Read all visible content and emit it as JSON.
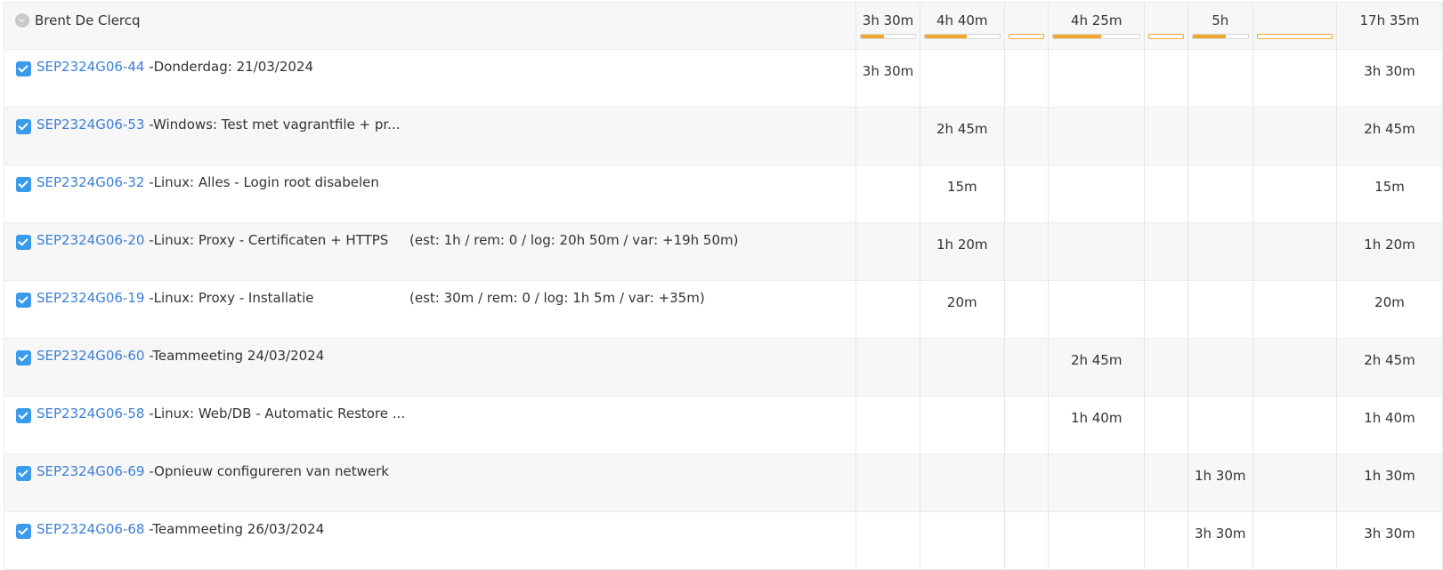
{
  "user": {
    "name": "Brent De Clercq"
  },
  "day_totals": [
    "3h 30m",
    "4h 40m",
    "",
    "4h 25m",
    "",
    "5h",
    "",
    "17h 35m"
  ],
  "day_progress": [
    0.42,
    0.56,
    0,
    0.55,
    0,
    0.6,
    0
  ],
  "rows": [
    {
      "key": "SEP2324G06-44",
      "title": " -Donderdag: 21/03/2024",
      "est": "",
      "values": [
        "3h 30m",
        "",
        "",
        "",
        "",
        "",
        "",
        "3h 30m"
      ]
    },
    {
      "key": "SEP2324G06-53",
      "title": " -Windows: Test met vagrantfile + pr...",
      "est": "",
      "values": [
        "",
        "2h 45m",
        "",
        "",
        "",
        "",
        "",
        "2h 45m"
      ]
    },
    {
      "key": "SEP2324G06-32",
      "title": " -Linux: Alles - Login root disabelen",
      "est": "",
      "values": [
        "",
        "15m",
        "",
        "",
        "",
        "",
        "",
        "15m"
      ]
    },
    {
      "key": "SEP2324G06-20",
      "title": " -Linux: Proxy - Certificaten + HTTPS",
      "est": "(est: 1h / rem: 0 / log: 20h 50m / var: +19h 50m)",
      "values": [
        "",
        "1h 20m",
        "",
        "",
        "",
        "",
        "",
        "1h 20m"
      ]
    },
    {
      "key": "SEP2324G06-19",
      "title": " -Linux: Proxy - Installatie",
      "est": "(est: 30m / rem: 0 / log: 1h 5m / var: +35m)",
      "values": [
        "",
        "20m",
        "",
        "",
        "",
        "",
        "",
        "20m"
      ]
    },
    {
      "key": "SEP2324G06-60",
      "title": " -Teammeeting 24/03/2024",
      "est": "",
      "values": [
        "",
        "",
        "",
        "2h 45m",
        "",
        "",
        "",
        "2h 45m"
      ]
    },
    {
      "key": "SEP2324G06-58",
      "title": " -Linux: Web/DB - Automatic Restore ...",
      "est": "",
      "values": [
        "",
        "",
        "",
        "1h 40m",
        "",
        "",
        "",
        "1h 40m"
      ]
    },
    {
      "key": "SEP2324G06-69",
      "title": " -Opnieuw configureren van netwerk",
      "est": "",
      "values": [
        "",
        "",
        "",
        "",
        "",
        "1h 30m",
        "",
        "1h 30m"
      ]
    },
    {
      "key": "SEP2324G06-68",
      "title": " -Teammeeting 26/03/2024",
      "est": "",
      "values": [
        "",
        "",
        "",
        "",
        "",
        "3h 30m",
        "",
        "3h 30m"
      ]
    }
  ],
  "colors": {
    "link": "#3d7fd6",
    "checkbox": "#3a9bea",
    "progress": "#f2a72a"
  }
}
